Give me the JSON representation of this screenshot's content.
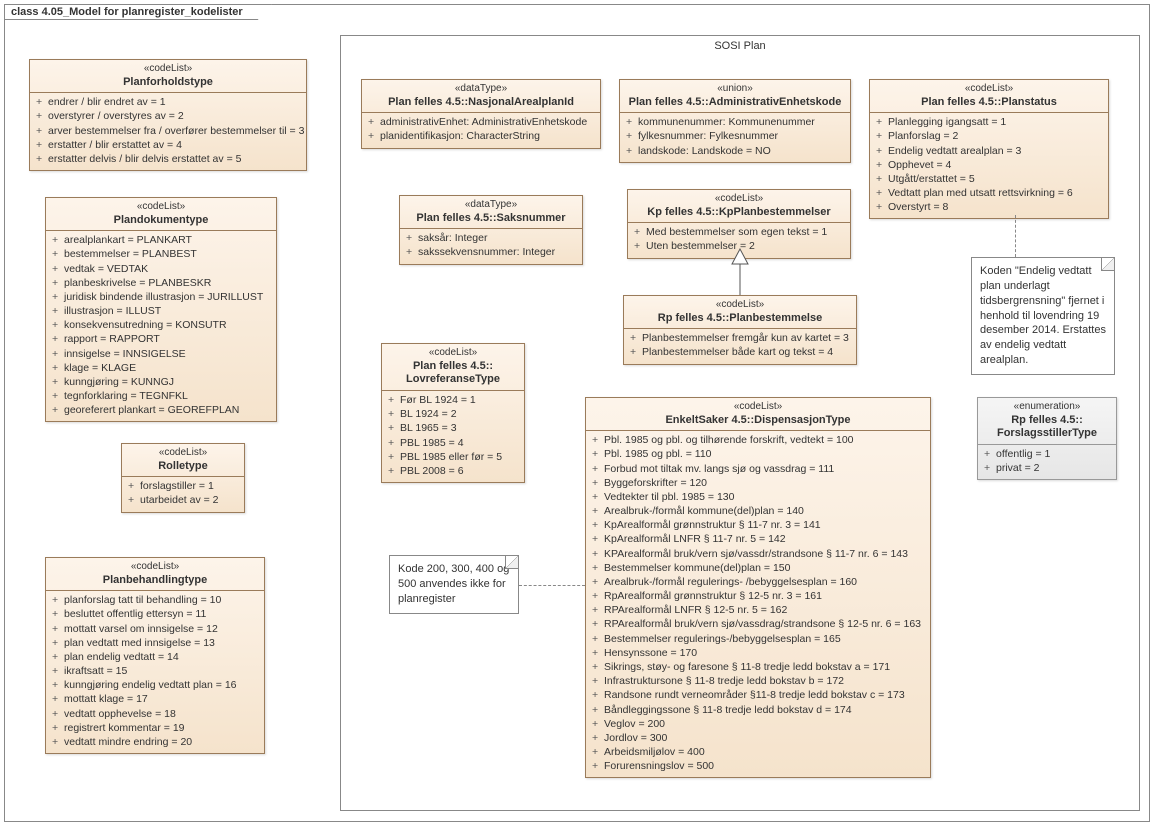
{
  "frame_title": "class 4.05_Model for planregister_kodelister",
  "package_name": "SOSI Plan",
  "classes": {
    "planforholdstype": {
      "stereo": "«codeList»",
      "name": "Planforholdstype",
      "items": [
        "endrer / blir endret av = 1",
        "overstyrer / overstyres av = 2",
        "arver bestemmelser fra / overfører bestemmelser til = 3",
        "erstatter / blir erstattet av = 4",
        "erstatter delvis / blir delvis erstattet av  = 5"
      ]
    },
    "plandokumenttype": {
      "stereo": "«codeList»",
      "name": "Plandokumentype",
      "items": [
        "arealplankart = PLANKART",
        "bestemmelser = PLANBEST",
        "vedtak = VEDTAK",
        "planbeskrivelse = PLANBESKR",
        "juridisk bindende illustrasjon = JURILLUST",
        "illustrasjon = ILLUST",
        "konsekvensutredning = KONSUTR",
        "rapport = RAPPORT",
        "innsigelse = INNSIGELSE",
        "klage = KLAGE",
        "kunngjøring = KUNNGJ",
        "tegnforklaring = TEGNFKL",
        "georeferert plankart = GEOREFPLAN"
      ]
    },
    "rolletype": {
      "stereo": "«codeList»",
      "name": "Rolletype",
      "items": [
        "forslagstiller = 1",
        "utarbeidet av = 2"
      ]
    },
    "planbehandlingtype": {
      "stereo": "«codeList»",
      "name": "Planbehandlingtype",
      "items": [
        "planforslag tatt til behandling = 10",
        "besluttet offentlig ettersyn = 11",
        "mottatt varsel om innsigelse = 12",
        "plan vedtatt med innsigelse = 13",
        "plan endelig vedtatt = 14",
        "ikraftsatt = 15",
        "kunngjøring endelig vedtatt plan = 16",
        "mottatt klage = 17",
        "vedtatt opphevelse = 18",
        "registrert kommentar = 19",
        "vedtatt mindre endring = 20"
      ]
    },
    "nasjonalArealplanId": {
      "stereo": "«dataType»",
      "name": "Plan felles 4.5::NasjonalArealplanId",
      "items": [
        "administrativEnhet: AdministrativEnhetskode",
        "planidentifikasjon: CharacterString"
      ]
    },
    "administrativEnhetskode": {
      "stereo": "«union»",
      "name": "Plan felles 4.5::AdministrativEnhetskode",
      "items": [
        "kommunenummer: Kommunenummer",
        "fylkesnummer: Fylkesnummer",
        "landskode: Landskode = NO"
      ]
    },
    "planstatus": {
      "stereo": "«codeList»",
      "name": "Plan felles 4.5::Planstatus",
      "items": [
        "Planlegging igangsatt = 1",
        "Planforslag = 2",
        "Endelig vedtatt arealplan = 3",
        "Opphevet = 4",
        "Utgått/erstattet = 5",
        "Vedtatt plan med utsatt rettsvirkning = 6",
        "Overstyrt = 8"
      ]
    },
    "saksnummer": {
      "stereo": "«dataType»",
      "name": "Plan felles 4.5::Saksnummer",
      "items": [
        "saksår: Integer",
        "sakssekvensnummer: Integer"
      ]
    },
    "kpPlanbestemmelser": {
      "stereo": "«codeList»",
      "name": "Kp felles 4.5::KpPlanbestemmelser",
      "items": [
        "Med bestemmelser som egen tekst = 1",
        "Uten bestemmelser = 2"
      ]
    },
    "rpPlanbestemmelse": {
      "stereo": "«codeList»",
      "name": "Rp felles 4.5::Planbestemmelse",
      "items": [
        "Planbestemmelser fremgår kun av kartet = 3",
        "Planbestemmelser både kart og tekst = 4"
      ]
    },
    "lovreferanseType": {
      "stereo": "«codeList»",
      "name": "Plan felles 4.5::\nLovreferanseType",
      "items": [
        "Før BL 1924 = 1",
        "BL 1924 = 2",
        "BL 1965 = 3",
        "PBL 1985 = 4",
        "PBL 1985 eller før = 5",
        "PBL 2008 = 6"
      ]
    },
    "dispensasjonType": {
      "stereo": "«codeList»",
      "name": "EnkeltSaker 4.5::DispensasjonType",
      "items": [
        "Pbl. 1985 og pbl. og tilhørende forskrift, vedtekt = 100",
        "Pbl. 1985 og pbl. = 110",
        "Forbud mot tiltak mv. langs sjø og vassdrag = 111",
        "Byggeforskrifter = 120",
        "Vedtekter til pbl. 1985 = 130",
        "Arealbruk-/formål kommune(del)plan = 140",
        "KpArealformål grønnstruktur § 11-7 nr. 3 = 141",
        "KpArealformål LNFR § 11-7 nr. 5 = 142",
        "KPArealformål bruk/vern sjø/vassdr/strandsone § 11-7 nr. 6 = 143",
        "Bestemmelser kommune(del)plan = 150",
        "Arealbruk-/formål regulerings- /bebyggelsesplan = 160",
        "RpArealformål grønnstruktur § 12-5 nr. 3 = 161",
        "RPArealformål LNFR § 12-5 nr. 5 = 162",
        "RPArealformål bruk/vern sjø/vassdrag/strandsone § 12-5 nr. 6 = 163",
        "Bestemmelser regulerings-/bebyggelsesplan = 165",
        "Hensynssone = 170",
        "Sikrings, støy- og faresone § 11-8 tredje  ledd bokstav a = 171",
        "Infrastruktursone § 11-8 tredje ledd bokstav b = 172",
        "Randsone rundt verneområder §11-8 tredje ledd bokstav c = 173",
        "Båndleggingssone § 11-8 tredje ledd bokstav d = 174",
        "Veglov = 200",
        "Jordlov = 300",
        "Arbeidsmiljølov = 400",
        "Forurensningslov = 500"
      ]
    },
    "forslagsstillerType": {
      "stereo": "«enumeration»",
      "name": "Rp felles 4.5::\nForslagsstillerType",
      "items": [
        "offentlig = 1",
        "privat = 2"
      ]
    }
  },
  "note1": "Koden \"Endelig vedtatt plan underlagt tidsbergrensning\" fjernet i henhold til lovendring 19 desember 2014. Erstattes av endelig vedtatt arealplan.",
  "note2": "Kode 200, 300, 400 og 500 anvendes ikke for planregister"
}
